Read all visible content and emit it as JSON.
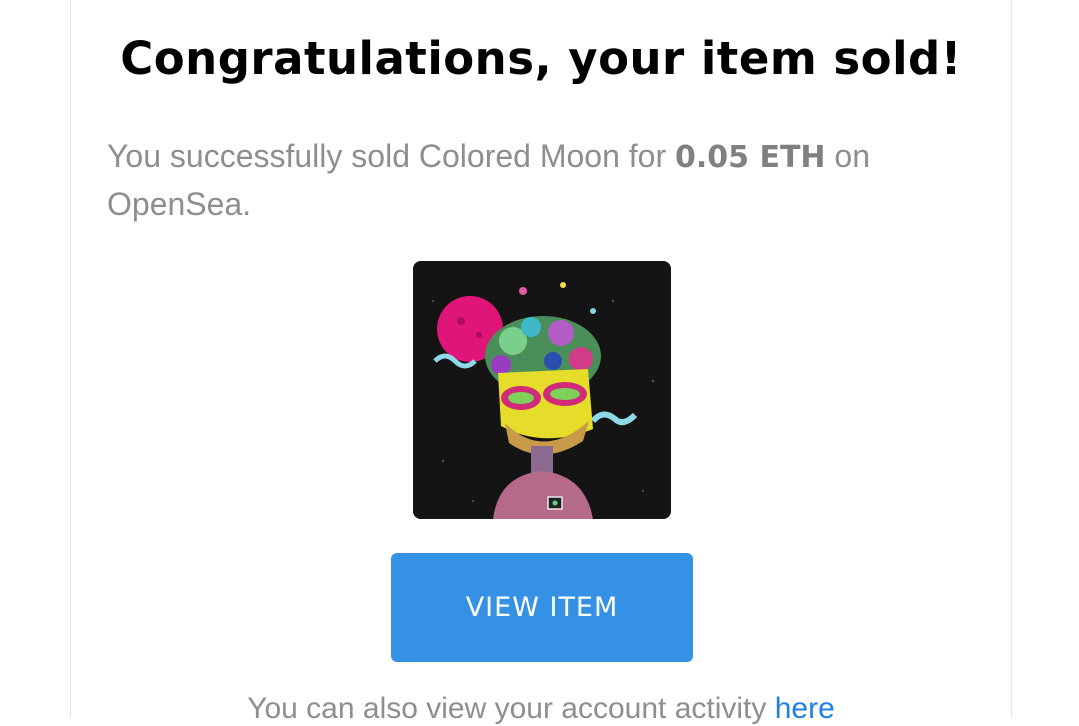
{
  "email": {
    "heading": "Congratulations, your item sold!",
    "message": {
      "prefix": "You successfully sold Colored Moon for ",
      "price": "0.05 ETH",
      "suffix": " on OpenSea."
    },
    "item_image_alt": "Colored Moon",
    "view_button_label": "VIEW ITEM",
    "footer": {
      "text": "You can also view your account activity ",
      "link_label": "here"
    }
  },
  "colors": {
    "button_bg": "#3591e4",
    "link": "#2081e2",
    "heading": "#000000",
    "body_text": "#8e8e8e"
  }
}
